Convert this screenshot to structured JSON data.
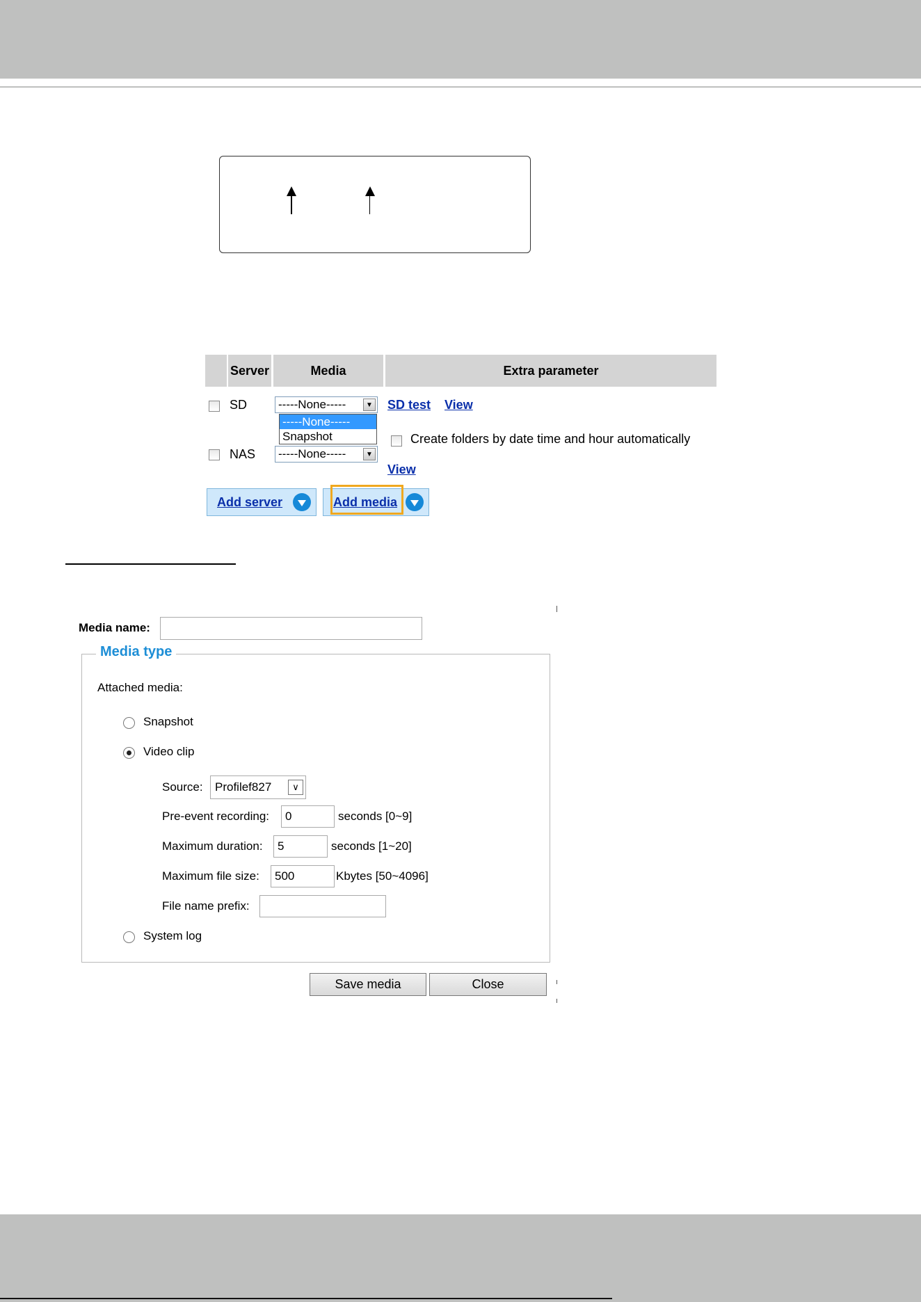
{
  "event_table": {
    "headers": [
      "Server",
      "Media",
      "Extra parameter"
    ],
    "rows": [
      {
        "server": "SD",
        "media": "-----None-----",
        "links": [
          "SD test",
          "View"
        ]
      },
      {
        "server": "NAS",
        "media": "-----None-----",
        "extra_checkbox": "Create folders by date time and hour automatically",
        "links": [
          "View"
        ]
      }
    ],
    "dropdown_options": [
      "-----None-----",
      "Snapshot"
    ],
    "add_server": "Add server",
    "add_media": "Add media"
  },
  "media_dialog": {
    "media_name_label": "Media name:",
    "media_name_value": "",
    "legend": "Media type",
    "attached_label": "Attached media:",
    "options": {
      "snapshot": "Snapshot",
      "video_clip": "Video clip",
      "system_log": "System log"
    },
    "selected": "Video clip",
    "source_label": "Source:",
    "source_value": "Profilef827",
    "pre_event_label": "Pre-event recording:",
    "pre_event_value": "0",
    "pre_event_unit": "seconds [0~9]",
    "max_duration_label": "Maximum duration:",
    "max_duration_value": "5",
    "max_duration_unit": "seconds [1~20]",
    "max_file_size_label": "Maximum file size:",
    "max_file_size_value": "500",
    "max_file_size_unit": "Kbytes [50~4096]",
    "file_prefix_label": "File name prefix:",
    "file_prefix_value": "",
    "save_button": "Save media",
    "close_button": "Close"
  },
  "colors": {
    "header_gray": "#bfc0bf",
    "link_blue": "#0a2faa",
    "legend_blue": "#1d8ed6",
    "highlight_orange": "#f0a81f"
  }
}
